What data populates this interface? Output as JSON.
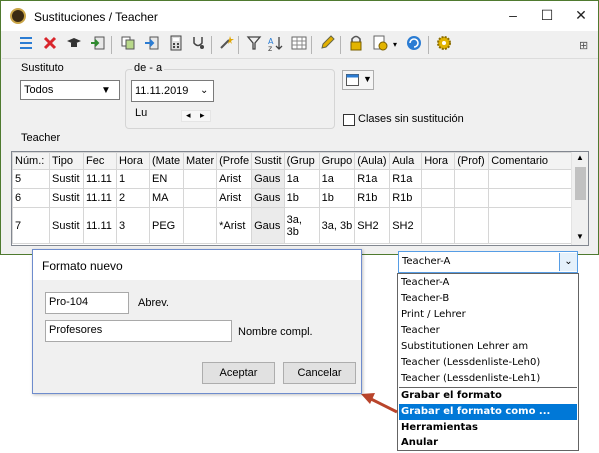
{
  "window": {
    "title": "Sustituciones / Teacher",
    "minimize": "–",
    "maximize": "☐",
    "close": "✕"
  },
  "toolbar": {
    "icons": [
      "list-icon",
      "delete-icon",
      "mortarboard-icon",
      "import-icon",
      "copy-icon",
      "export-icon",
      "calculator-icon",
      "stethoscope-icon",
      "magic-wand-icon",
      "filter-icon",
      "sort-icon",
      "grid-icon",
      "pen-icon",
      "lock-icon",
      "settings-page-icon",
      "refresh-icon",
      "gear-icon"
    ],
    "pin": "⊞"
  },
  "filters": {
    "sustituto_label": "Sustituto",
    "sustituto_value": "Todos",
    "range_label": "de - a",
    "date_value": "11.11.2019",
    "weekday": "Lu",
    "nav_prev": "◂",
    "nav_next": "▸",
    "clases_sin_label": "Clases sin sustitución",
    "teacher_label": "Teacher"
  },
  "grid": {
    "columns": [
      "Núm.:",
      "Tipo",
      "Fec",
      "Hora",
      "(Mate",
      "Mater",
      "(Profe",
      "Sustit",
      "(Grup",
      "Grupo",
      "(Aula)",
      "Aula",
      "Hora",
      "(Prof)",
      "Comentario"
    ],
    "rows": [
      [
        "5",
        "Sustit",
        "11.11",
        "1",
        "EN",
        "",
        "Arist",
        "Gaus",
        "1a",
        "1a",
        "R1a",
        "R1a",
        "",
        "",
        ""
      ],
      [
        "6",
        "Sustit",
        "11.11",
        "2",
        "MA",
        "",
        "Arist",
        "Gaus",
        "1b",
        "1b",
        "R1b",
        "R1b",
        "",
        "",
        ""
      ],
      [
        "7",
        "Sustit",
        "11.11",
        "3",
        "PEG",
        "",
        "*Arist",
        "Gaus",
        "3a, 3b",
        "3a, 3b",
        "SH2",
        "SH2",
        "",
        "",
        ""
      ]
    ],
    "scroll_up": "▲",
    "scroll_down": "▼"
  },
  "dialog": {
    "title": "Formato nuevo",
    "abbrev_value": "Pro-104",
    "abbrev_label": "Abrev.",
    "name_value": "Profesores",
    "name_label": "Nombre compl.",
    "ok": "Aceptar",
    "cancel": "Cancelar"
  },
  "format_dropdown": {
    "selected": "Teacher-A",
    "items": [
      "Teacher-A",
      "Teacher-B",
      "Print / Lehrer",
      "Teacher",
      "Substitutionen Lehrer am",
      "Teacher (Lessdenliste-Leh0)",
      "Teacher (Lessdenliste-Leh1)"
    ],
    "actions": [
      "Grabar el formato",
      "Grabar el formato como ...",
      "Herramientas",
      "Anular"
    ],
    "highlighted_action": "Grabar el formato como ..."
  },
  "colors": {
    "accent": "#0078d7",
    "arrow": "#b9442b",
    "highlight_cell": "#fff2cc"
  }
}
